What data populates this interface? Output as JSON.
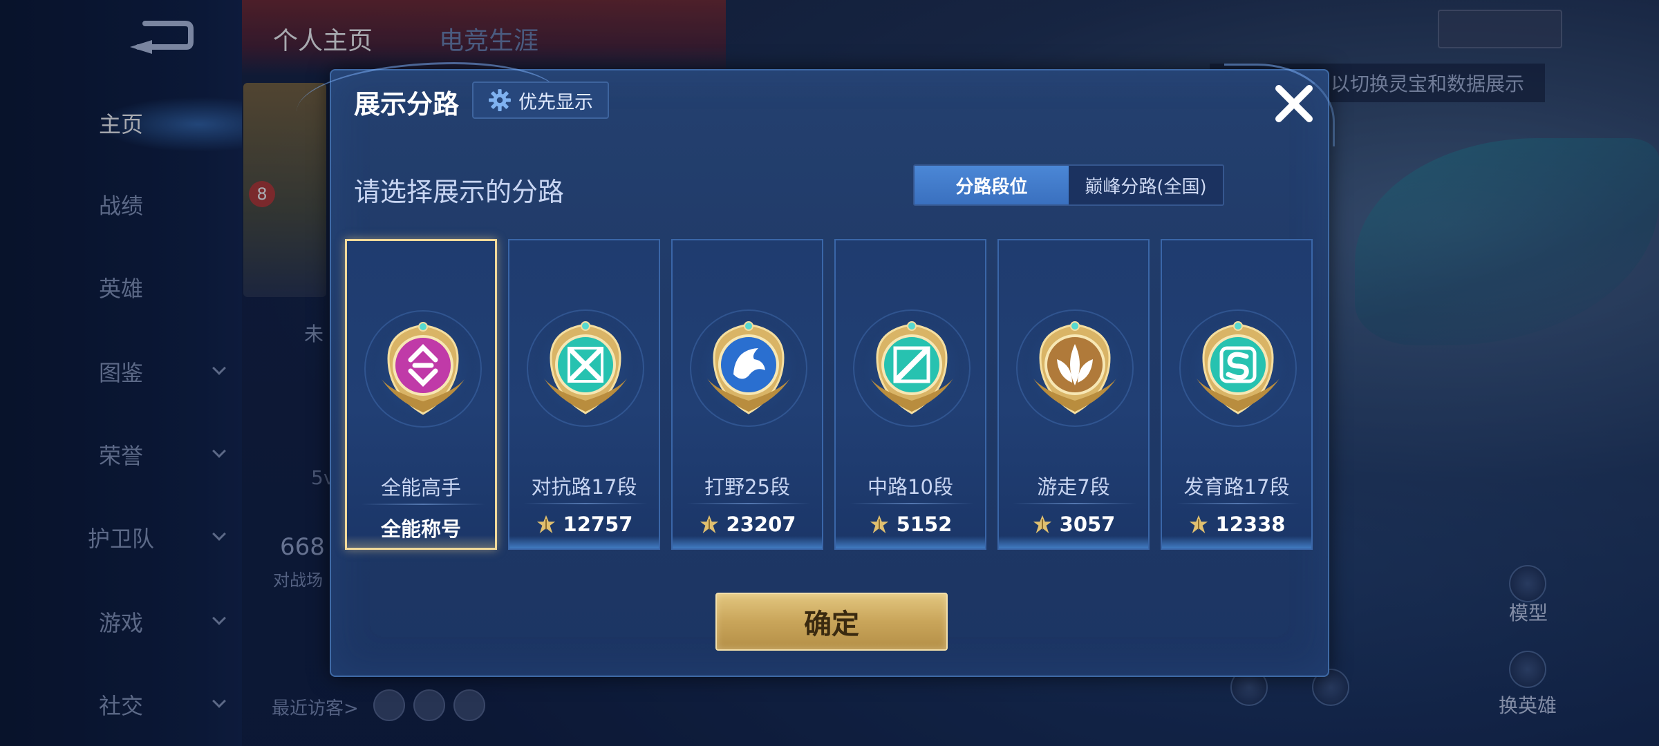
{
  "background": {
    "nav": [
      {
        "label": "主页",
        "active": true,
        "chevron": false
      },
      {
        "label": "战绩",
        "active": false,
        "chevron": false
      },
      {
        "label": "英雄",
        "active": false,
        "chevron": false
      },
      {
        "label": "图鉴",
        "active": false,
        "chevron": true
      },
      {
        "label": "荣誉",
        "active": false,
        "chevron": true
      },
      {
        "label": "护卫队",
        "active": false,
        "chevron": true
      },
      {
        "label": "游戏",
        "active": false,
        "chevron": true
      },
      {
        "label": "社交",
        "active": false,
        "chevron": true
      }
    ],
    "top_tabs": [
      "个人主页",
      "电竞生涯"
    ],
    "level_badge": "8",
    "partial_text_wei": "未",
    "partial_text_5v": "5v",
    "partial_number": "668",
    "partial_label": "对战场",
    "visitors_label": "最近访客>",
    "hint_text": "以切换灵宝和数据展示",
    "model_label": "模型",
    "change_hero_label": "换英雄"
  },
  "modal": {
    "title": "展示分路",
    "priority_button": "优先显示",
    "subtitle": "请选择展示的分路",
    "toggles": [
      {
        "label": "分路段位",
        "active": true
      },
      {
        "label": "巅峰分路(全国)",
        "active": false
      }
    ],
    "cards": [
      {
        "name": "全能高手",
        "value": "全能称号",
        "selected": true,
        "has_score_icon": false,
        "medal": "all-round",
        "color": "#c03aa8"
      },
      {
        "name": "对抗路17段",
        "value": "12757",
        "selected": false,
        "has_score_icon": true,
        "medal": "clash-lane",
        "color": "#27c2b0"
      },
      {
        "name": "打野25段",
        "value": "23207",
        "selected": false,
        "has_score_icon": true,
        "medal": "jungle",
        "color": "#2a6fd0"
      },
      {
        "name": "中路10段",
        "value": "5152",
        "selected": false,
        "has_score_icon": true,
        "medal": "mid-lane",
        "color": "#27c2b0"
      },
      {
        "name": "游走7段",
        "value": "3057",
        "selected": false,
        "has_score_icon": true,
        "medal": "roam",
        "color": "#b07a3a"
      },
      {
        "name": "发育路17段",
        "value": "12338",
        "selected": false,
        "has_score_icon": true,
        "medal": "farm-lane",
        "color": "#27c2b0"
      }
    ],
    "confirm_button": "确定"
  },
  "colors": {
    "accent_gold": "#e2c67f",
    "toggle_active": "#4b87d6",
    "modal_bg": "#213c6c"
  }
}
